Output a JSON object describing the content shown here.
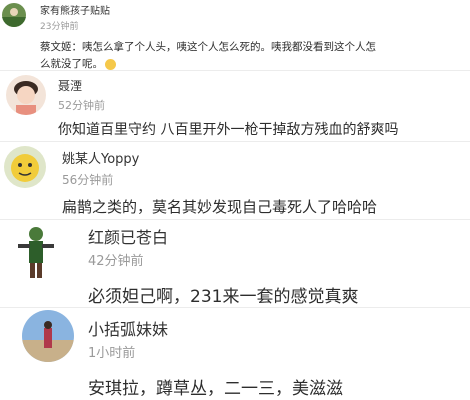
{
  "comments": [
    {
      "user": "家有熊孩子贴贴",
      "time": "23分钟前",
      "text_line1": "蔡文姬：咦怎么拿了个人头，咦这个人怎么死的。咦我都没看到这个人怎",
      "text_line2": "么就没了呢。",
      "emoji": "smile-emoji"
    },
    {
      "user": "聂湮",
      "time": "52分钟前",
      "text": "你知道百里守约 八百里开外一枪干掉敌方残血的舒爽吗"
    },
    {
      "user": "姚某人Yoppy",
      "time": "56分钟前",
      "text": "扁鹊之类的，莫名其妙发现自己毒死人了哈哈哈"
    },
    {
      "user": "红颜已苍白",
      "time": "42分钟前",
      "text": "必须妲己啊，231来一套的感觉真爽"
    },
    {
      "user": "小括弧妹妹",
      "time": "1小时前",
      "text": "安琪拉，蹲草丛，二一三，美滋滋"
    }
  ]
}
